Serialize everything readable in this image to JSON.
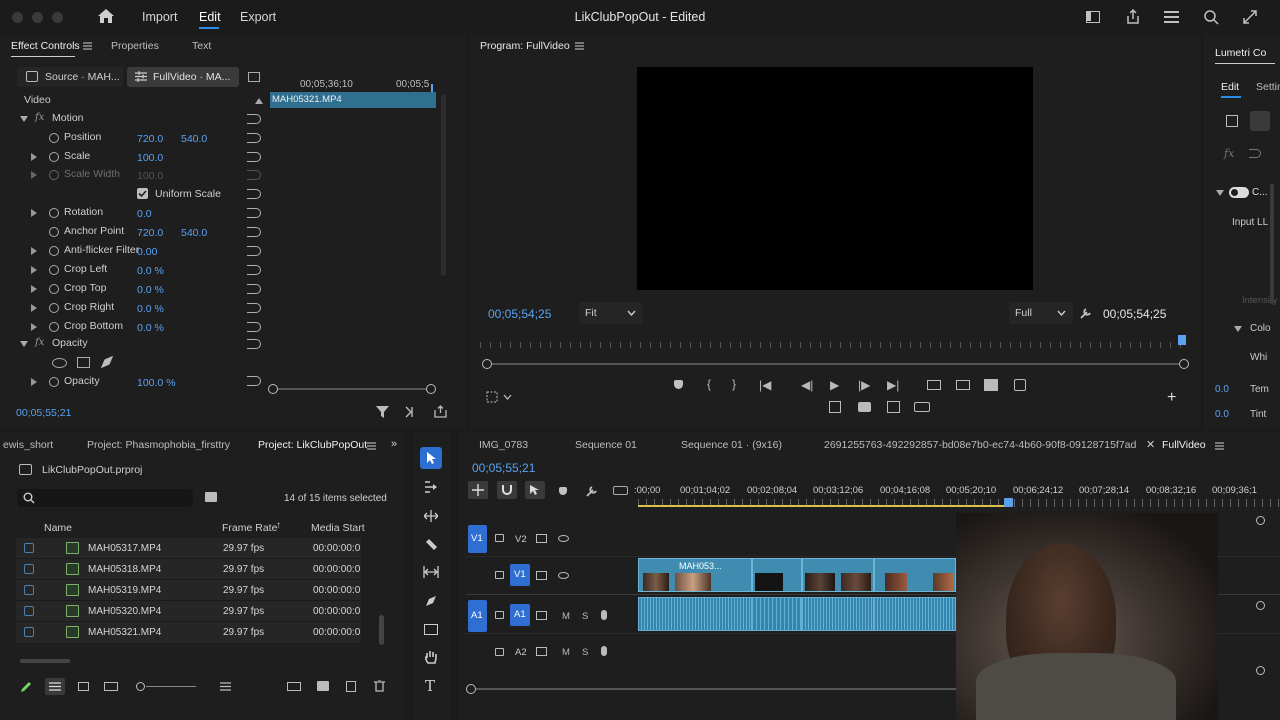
{
  "titlebar": {
    "menu": [
      "Import",
      "Edit",
      "Export"
    ],
    "active_menu": "Edit",
    "title": "LikClubPopOut - Edited"
  },
  "effect_controls": {
    "tabs": [
      "Effect Controls",
      "Properties",
      "Text"
    ],
    "source_tab": "Source · MAH...",
    "seq_tab": "FullVideo · MA...",
    "ruler_left": "00;05;36;10",
    "ruler_right": "00;05;5",
    "clip_name": "MAH05321.MP4",
    "section_video": "Video",
    "motion": "Motion",
    "position_label": "Position",
    "position_x": "720.0",
    "position_y": "540.0",
    "scale_label": "Scale",
    "scale_value": "100.0",
    "scale_width_label": "Scale Width",
    "scale_width_value": "100.0",
    "uniform_scale_label": "Uniform Scale",
    "rotation_label": "Rotation",
    "rotation_value": "0.0",
    "anchor_label": "Anchor Point",
    "anchor_x": "720.0",
    "anchor_y": "540.0",
    "antiflicker_label": "Anti-flicker Filter",
    "antiflicker_value": "0.00",
    "crop_left_label": "Crop Left",
    "crop_left_value": "0.0 %",
    "crop_top_label": "Crop Top",
    "crop_top_value": "0.0 %",
    "crop_right_label": "Crop Right",
    "crop_right_value": "0.0 %",
    "crop_bottom_label": "Crop Bottom",
    "crop_bottom_value": "0.0 %",
    "opacity_section": "Opacity",
    "opacity_label": "Opacity",
    "opacity_value": "100.0 %",
    "timecode": "00;05;55;21"
  },
  "program": {
    "title": "Program: FullVideo",
    "timecode_left": "00;05;54;25",
    "fit": "Fit",
    "quality": "Full",
    "timecode_right": "00;05;54;25"
  },
  "lumetri": {
    "title": "Lumetri Co",
    "tab_edit": "Edit",
    "tab_settings": "Settin",
    "toggle_label": "C...",
    "input_lut": "Input LL",
    "intensity": "Intensity",
    "color": "Colo",
    "white": "Whi",
    "temp_label": "Tem",
    "temp_value": "0.0",
    "tint_label": "Tint",
    "tint_value": "0.0"
  },
  "project": {
    "tabs": [
      "ewis_short",
      "Project: Phasmophobia_firsttry",
      "Project: LikClubPopOut"
    ],
    "file": "LikClubPopOut.prproj",
    "search_placeholder": "",
    "selected": "14 of 15 items selected",
    "columns": [
      "Name",
      "Frame Rate",
      "Media Start"
    ],
    "rows": [
      {
        "name": "MAH05317.MP4",
        "fps": "29.97 fps",
        "start": "00:00:00:0"
      },
      {
        "name": "MAH05318.MP4",
        "fps": "29.97 fps",
        "start": "00:00:00:0"
      },
      {
        "name": "MAH05319.MP4",
        "fps": "29.97 fps",
        "start": "00:00:00:0"
      },
      {
        "name": "MAH05320.MP4",
        "fps": "29.97 fps",
        "start": "00:00:00:0"
      },
      {
        "name": "MAH05321.MP4",
        "fps": "29.97 fps",
        "start": "00:00:00:0"
      }
    ]
  },
  "timeline": {
    "tabs": [
      "IMG_0783",
      "Sequence 01",
      "Sequence 01 · (9x16)",
      "2691255763-492292857-bd08e7b0-ec74-4b60-90f8-09128715f7ad",
      "FullVideo"
    ],
    "timecode": "00;05;55;21",
    "ruler": [
      ":00;00",
      "00;01;04;02",
      "00;02;08;04",
      "00;03;12;06",
      "00;04;16;08",
      "00;05;20;10",
      "00;06;24;12",
      "00;07;28;14",
      "00;08;32;16",
      "00;09;36;1"
    ],
    "tracks": {
      "v2": "V2",
      "v1": "V1",
      "a1": "A1",
      "a2": "A2",
      "src_v1": "V1",
      "src_a1": "A1",
      "m": "M",
      "s": "S"
    },
    "clip_label": "MAH053..."
  },
  "colors": {
    "accent": "#2d8ceb",
    "clip_video": "#3f8cb0",
    "clip_audio": "#3784aa",
    "track_target": "#2f6fd1"
  }
}
